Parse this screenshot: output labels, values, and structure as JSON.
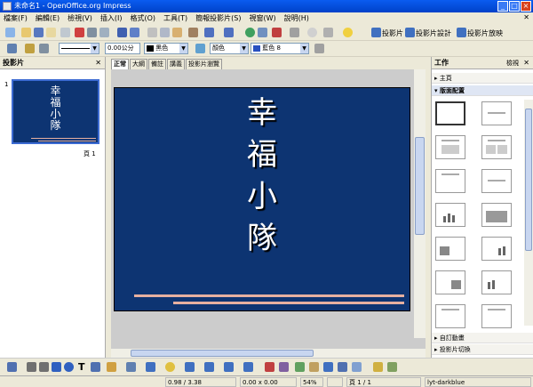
{
  "window": {
    "title": "未命名1 - OpenOffice.org Impress"
  },
  "menu": [
    "檔案(F)",
    "編輯(E)",
    "檢視(V)",
    "插入(I)",
    "格式(O)",
    "工具(T)",
    "簡報投影片(S)",
    "視窗(W)",
    "說明(H)"
  ],
  "toolbar": {
    "slide_show": "投影片",
    "slide_design": "投影片設計",
    "slide_play": "投影片放映",
    "line_width": "0.00公分",
    "line_color": "黑色",
    "area_style": "顏色",
    "area_color": "藍色 8"
  },
  "slides_pane": {
    "title": "投影片",
    "slide_number": "1",
    "page_label": "頁 1"
  },
  "tabs": [
    "正常",
    "大綱",
    "備註",
    "講義",
    "投影片瀏覽"
  ],
  "slide": {
    "title_chars": [
      "幸",
      "福",
      "小",
      "隊"
    ]
  },
  "tasks_pane": {
    "title": "工作",
    "view_label": "檢視",
    "sections": {
      "master": "主頁",
      "layouts": "版面配置",
      "custom_animation": "自訂動畫",
      "transition": "投影片切換"
    }
  },
  "status": {
    "position": "0.98 / 3.38",
    "size": "0.00 x 0.00",
    "zoom": "54%",
    "page": "頁 1 / 1",
    "master": "lyt-darkblue"
  },
  "colors": {
    "slide_bg": "#0d3472",
    "accent_line": "#e6b0a0",
    "title_bar": "#0041c8"
  }
}
